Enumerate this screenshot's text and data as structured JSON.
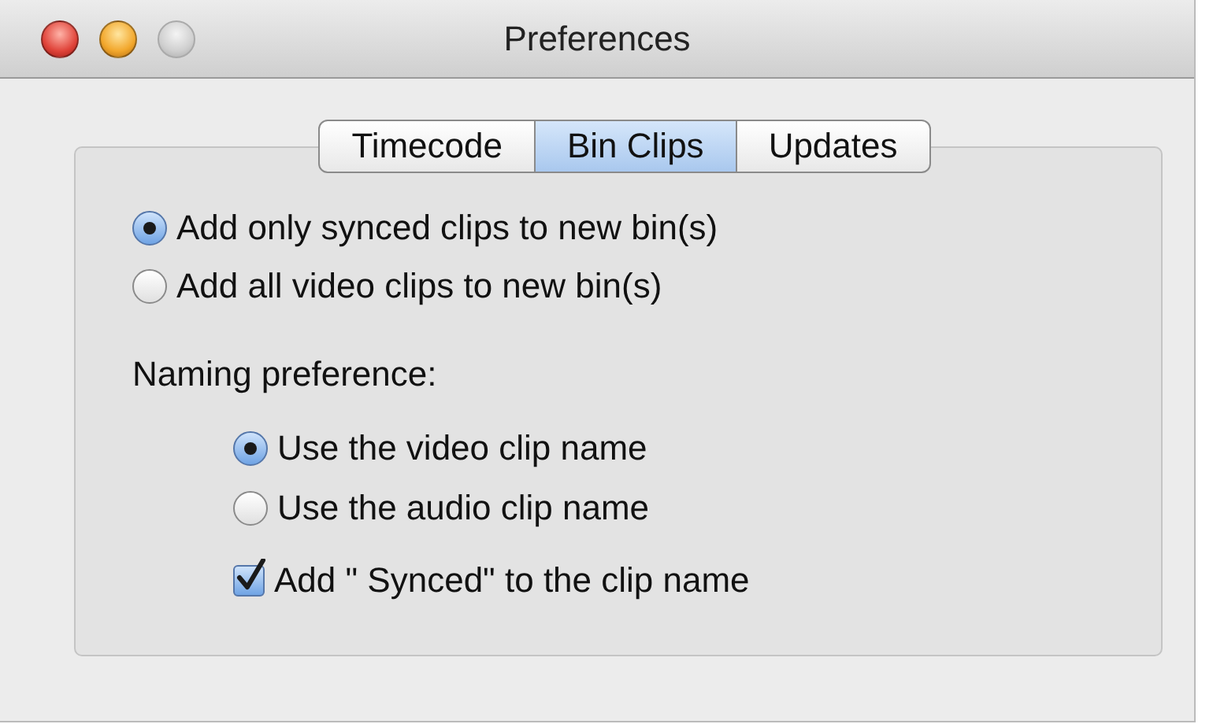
{
  "window": {
    "title": "Preferences",
    "controls": [
      {
        "kind": "close",
        "disabled": false
      },
      {
        "kind": "minimize",
        "disabled": false
      },
      {
        "kind": "zoom",
        "disabled": true
      }
    ]
  },
  "tabs": [
    {
      "label": "Timecode",
      "selected": false
    },
    {
      "label": "Bin Clips",
      "selected": true
    },
    {
      "label": "Updates",
      "selected": false
    }
  ],
  "bin_options": [
    {
      "label": "Add only synced clips to new bin(s)",
      "selected": true
    },
    {
      "label": "Add all video clips to new bin(s)",
      "selected": false
    }
  ],
  "naming": {
    "label": "Naming preference:",
    "options": [
      {
        "label": "Use the video clip name",
        "selected": true
      },
      {
        "label": "Use the audio clip name",
        "selected": false
      }
    ],
    "checkbox": {
      "label": "Add \" Synced\" to the clip name",
      "checked": true
    }
  }
}
